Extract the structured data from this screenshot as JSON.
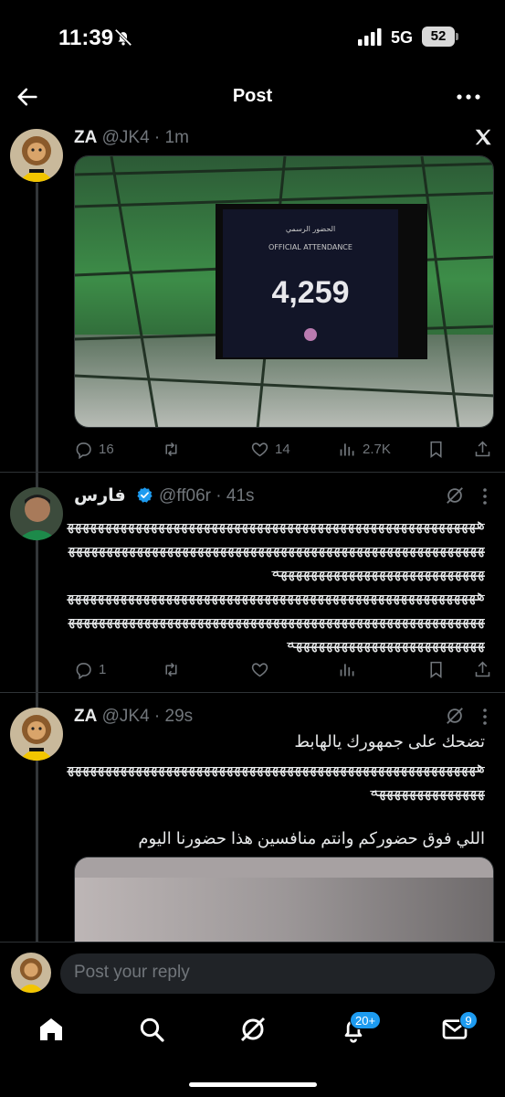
{
  "status": {
    "time": "11:39",
    "network": "5G",
    "battery": "52"
  },
  "header": {
    "title": "Post"
  },
  "tweets": [
    {
      "name": "ZA",
      "handle": "@JK4",
      "time": "1m",
      "media": {
        "board_label_ar": "الحضور الرسمي",
        "board_label_en": "OFFICIAL ATTENDANCE",
        "board_value": "4,259"
      },
      "stats": {
        "replies": "16",
        "reposts": "",
        "likes": "14",
        "views": "2.7K"
      }
    },
    {
      "name": "فارس",
      "handle": "@ff06r",
      "time": "41s",
      "text": "هههههههههههههههههههههههههههههههههههههههههههههههههههههههههههههههههههههههههههههههههههههههههههههههههههههههههههههههههههههههههههههههههههههههههه\nهههههههههههههههههههههههههههههههههههههههههههههههههههههههههههههههههههههههههههههههههههههههههههههههههههههههههههههههههههههههههههههههههههههههه",
      "stats": {
        "replies": "1",
        "reposts": "",
        "likes": "",
        "views": ""
      }
    },
    {
      "name": "ZA",
      "handle": "@JK4",
      "time": "29s",
      "text_line1": "تضحك على جمهورك يالهابط",
      "laugh": "هههههههههههههههههههههههههههههههههههههههههههههههههههههههههههههههههههههه",
      "text_line2": "اللي فوق حضوركم وانتم منافسين هذا حضورنا اليوم"
    }
  ],
  "reply": {
    "placeholder": "Post your reply"
  },
  "tabbar": {
    "notifications_badge": "20+",
    "messages_badge": "9"
  },
  "colors": {
    "accent": "#1d9bf0",
    "muted": "#71767b",
    "divider": "#2f3336"
  }
}
